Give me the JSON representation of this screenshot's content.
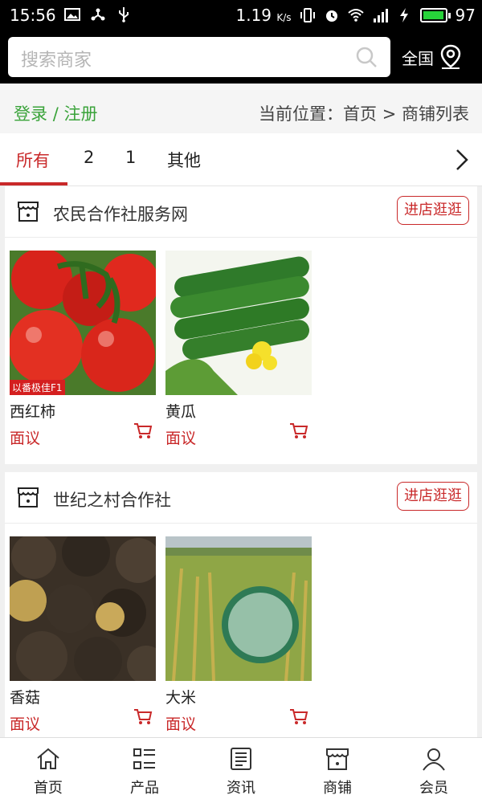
{
  "status_bar": {
    "time": "15:56",
    "network_speed": "1.19",
    "network_unit": "K/s",
    "battery": "97",
    "battery_level": 0.97,
    "battery_color": "#27d23a"
  },
  "search": {
    "placeholder": "搜索商家",
    "region_label": "全国"
  },
  "subbar": {
    "login": "登录",
    "separator": "/",
    "register": "注册",
    "breadcrumb": "当前位置：首页 > 商铺列表"
  },
  "tabs": [
    {
      "label": "所有",
      "active": true
    },
    {
      "label": "2",
      "active": false
    },
    {
      "label": "1",
      "active": false
    },
    {
      "label": "其他",
      "active": false
    }
  ],
  "shops": [
    {
      "name": "农民合作社服务网",
      "enter_label": "进店逛逛",
      "products": [
        {
          "name": "西红柿",
          "price": "面议",
          "image": "tomatoes",
          "tag": "以番极佳F1"
        },
        {
          "name": "黄瓜",
          "price": "面议",
          "image": "cucumbers"
        }
      ]
    },
    {
      "name": "世纪之村合作社",
      "enter_label": "进店逛逛",
      "products": [
        {
          "name": "香菇",
          "price": "面议",
          "image": "shiitake-mushrooms"
        },
        {
          "name": "大米",
          "price": "面议",
          "image": "rice-field"
        }
      ]
    }
  ],
  "bottom_nav": [
    {
      "label": "首页",
      "icon": "home-icon"
    },
    {
      "label": "产品",
      "icon": "list-icon"
    },
    {
      "label": "资讯",
      "icon": "news-icon"
    },
    {
      "label": "商铺",
      "icon": "store-icon"
    },
    {
      "label": "会员",
      "icon": "user-icon"
    }
  ],
  "colors": {
    "accent": "#c9292a",
    "login_green": "#3aa33a",
    "header_bg": "#000000"
  }
}
